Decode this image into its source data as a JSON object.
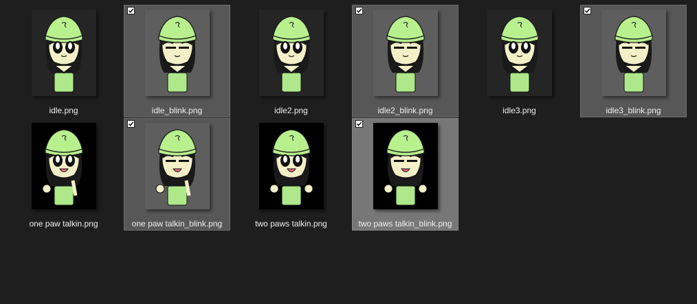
{
  "files": [
    {
      "name": "idle.png",
      "selected": false,
      "focused": false,
      "bg": "#252525",
      "face": "open",
      "arms": "hug"
    },
    {
      "name": "idle_blink.png",
      "selected": true,
      "focused": false,
      "bg": "#5e5e5e",
      "face": "blink",
      "arms": "hug"
    },
    {
      "name": "idle2.png",
      "selected": false,
      "focused": false,
      "bg": "#252525",
      "face": "open",
      "arms": "hug"
    },
    {
      "name": "idle2_blink.png",
      "selected": true,
      "focused": false,
      "bg": "#5e5e5e",
      "face": "blink",
      "arms": "hug"
    },
    {
      "name": "idle3.png",
      "selected": false,
      "focused": false,
      "bg": "#252525",
      "face": "open",
      "arms": "hug"
    },
    {
      "name": "idle3_blink.png",
      "selected": true,
      "focused": false,
      "bg": "#5e5e5e",
      "face": "blink",
      "arms": "hug"
    },
    {
      "name": "one paw talkin.png",
      "selected": false,
      "focused": false,
      "bg": "#000000",
      "face": "talk",
      "arms": "one"
    },
    {
      "name": "one paw talkin_blink.png",
      "selected": true,
      "focused": false,
      "bg": "#5e5e5e",
      "face": "talkblink",
      "arms": "one"
    },
    {
      "name": "two paws talkin.png",
      "selected": false,
      "focused": false,
      "bg": "#000000",
      "face": "talk",
      "arms": "two"
    },
    {
      "name": "two paws talkin_blink.png",
      "selected": true,
      "focused": true,
      "bg": "#000000",
      "face": "talkblink",
      "arms": "two"
    }
  ],
  "colors": {
    "hat": "#b8f08e",
    "hat_outline": "#1a1a1a",
    "hair": "#1a1a1a",
    "skin": "#f3f0c8",
    "shirt": "#aee88a",
    "mouth": "#e06a7a"
  }
}
